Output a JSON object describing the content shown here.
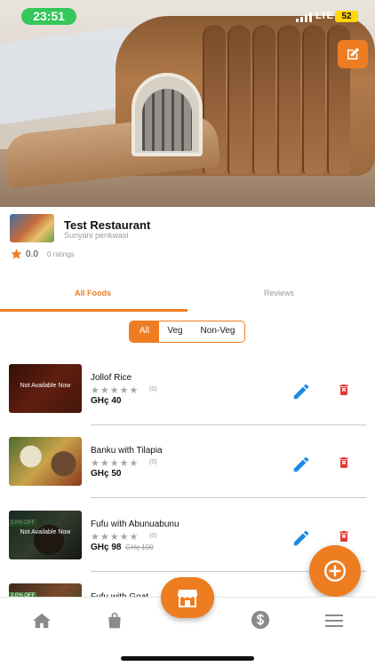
{
  "status_bar": {
    "time": "23:51",
    "network": "LTE",
    "battery": "52"
  },
  "restaurant": {
    "name": "Test Restaurant",
    "address": "Sunyani penkwasi",
    "rating": "0.0",
    "ratings_count": "0 ratings"
  },
  "tabs": [
    {
      "label": "All Foods",
      "active": true
    },
    {
      "label": "Reviews",
      "active": false
    }
  ],
  "filter": {
    "options": [
      "All",
      "Veg",
      "Non-Veg"
    ],
    "selected": "All"
  },
  "foods": [
    {
      "name": "Jollof Rice",
      "stars": "★★★★★",
      "rating_count": "(0)",
      "price": "GHç 40",
      "old_price": "",
      "badge": "Not Available Now",
      "discount": ""
    },
    {
      "name": "Banku with Tilapia",
      "stars": "★★★★★",
      "rating_count": "(0)",
      "price": "GHç 50",
      "old_price": "",
      "badge": "",
      "discount": ""
    },
    {
      "name": "Fufu with Abunuabunu",
      "stars": "★★★★★",
      "rating_count": "(0)",
      "price": "GHç 98",
      "old_price": "GHç 100",
      "badge": "Not Available Now",
      "discount": "2.0% OFF"
    },
    {
      "name": "Fufu with Goat",
      "discount": "2.0% OFF"
    }
  ],
  "colors": {
    "accent": "#ee7d22",
    "edit": "#1e88e5",
    "delete": "#e53935"
  },
  "icons": {
    "edit_cover": "edit-square-icon",
    "edit": "pencil-icon",
    "delete": "trash-icon",
    "fab": "plus-circle-icon",
    "nav": [
      "home-icon",
      "bag-icon",
      "store-icon",
      "dollar-icon",
      "menu-icon"
    ]
  }
}
